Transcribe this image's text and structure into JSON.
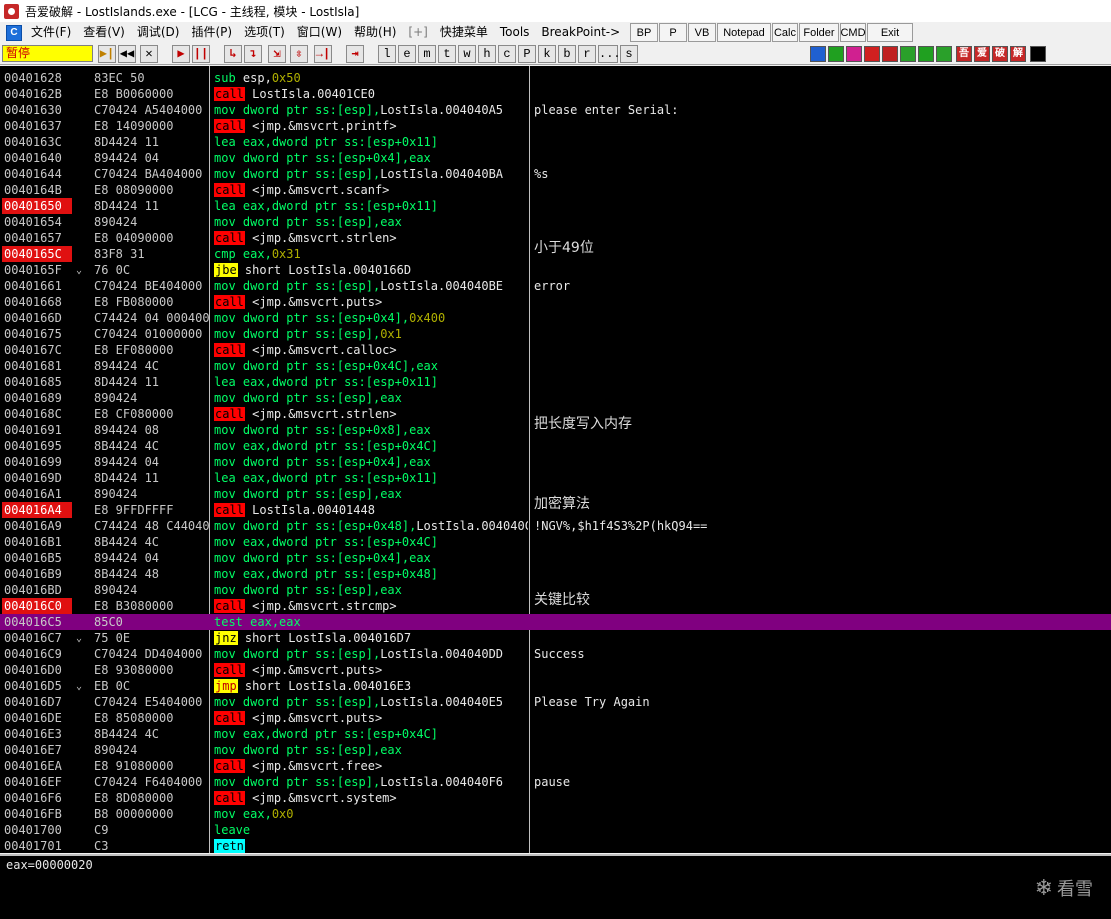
{
  "window": {
    "title": "吾爱破解 - LostIslands.exe - [LCG - 主线程, 模块 - LostIsla]"
  },
  "menu": {
    "system_icon_label": "C",
    "items": [
      "文件(F)",
      "查看(V)",
      "调试(D)",
      "插件(P)",
      "选项(T)",
      "窗口(W)",
      "帮助(H)",
      "[+]",
      "快捷菜单",
      "Tools",
      "BreakPoint->"
    ],
    "plugins": [
      "BP",
      "P",
      "VB",
      "Notepad",
      "Calc",
      "Folder",
      "CMD",
      "Exit"
    ]
  },
  "toolbar": {
    "status": "暂停",
    "buttons": [
      "▶|",
      "◀◀",
      "✕",
      "▶",
      "||",
      "↳",
      "↴",
      "⇲",
      "⇳",
      "→|",
      "⇥"
    ],
    "letters": [
      "l",
      "e",
      "m",
      "t",
      "w",
      "h",
      "c",
      "P",
      "k",
      "b",
      "r",
      "...",
      "s"
    ],
    "right_icons": [
      "吾",
      "爱",
      "破",
      "解"
    ]
  },
  "disasm": {
    "rows": [
      {
        "addr": "00401628",
        "bp": false,
        "j": "",
        "hex": "83EC 50",
        "m": "sub",
        "mt": "normal",
        "ops": [
          [
            "esp,",
            "w"
          ],
          [
            "0x50",
            "g"
          ]
        ],
        "cmt": "",
        "cn": false
      },
      {
        "addr": "0040162B",
        "bp": false,
        "j": "",
        "hex": "E8 B0060000",
        "m": "call",
        "mt": "call",
        "ops": [
          [
            "LostIsla.00401CE0",
            "w"
          ]
        ],
        "cmt": "",
        "cn": false
      },
      {
        "addr": "00401630",
        "bp": false,
        "j": "",
        "hex": "C70424 A5404000",
        "m": "mov",
        "mt": "normal",
        "ops": [
          [
            "dword ptr ss:[esp],",
            "g"
          ],
          [
            "LostIsla.004040A5",
            "w"
          ]
        ],
        "cmt": "please enter Serial:",
        "cn": false
      },
      {
        "addr": "00401637",
        "bp": false,
        "j": "",
        "hex": "E8 14090000",
        "m": "call",
        "mt": "call",
        "ops": [
          [
            "<jmp.&msvcrt.printf>",
            "w"
          ]
        ],
        "cmt": "",
        "cn": false
      },
      {
        "addr": "0040163C",
        "bp": false,
        "j": "",
        "hex": "8D4424 11",
        "m": "lea",
        "mt": "normal",
        "ops": [
          [
            "eax,dword ptr ss:[esp+0x11]",
            "g"
          ]
        ],
        "cmt": "",
        "cn": false
      },
      {
        "addr": "00401640",
        "bp": false,
        "j": "",
        "hex": "894424 04",
        "m": "mov",
        "mt": "normal",
        "ops": [
          [
            "dword ptr ss:[esp+0x4],eax",
            "g"
          ]
        ],
        "cmt": "",
        "cn": false
      },
      {
        "addr": "00401644",
        "bp": false,
        "j": "",
        "hex": "C70424 BA404000",
        "m": "mov",
        "mt": "normal",
        "ops": [
          [
            "dword ptr ss:[esp],",
            "g"
          ],
          [
            "LostIsla.004040BA",
            "w"
          ]
        ],
        "cmt": "%s",
        "cn": false
      },
      {
        "addr": "0040164B",
        "bp": false,
        "j": "",
        "hex": "E8 08090000",
        "m": "call",
        "mt": "call",
        "ops": [
          [
            "<jmp.&msvcrt.scanf>",
            "w"
          ]
        ],
        "cmt": "",
        "cn": false
      },
      {
        "addr": "00401650",
        "bp": true,
        "j": "",
        "hex": "8D4424 11",
        "m": "lea",
        "mt": "normal",
        "ops": [
          [
            "eax,dword ptr ss:[esp+0x11]",
            "g"
          ]
        ],
        "cmt": "",
        "cn": false
      },
      {
        "addr": "00401654",
        "bp": false,
        "j": "",
        "hex": "890424",
        "m": "mov",
        "mt": "normal",
        "ops": [
          [
            "dword ptr ss:[esp],eax",
            "g"
          ]
        ],
        "cmt": "",
        "cn": false
      },
      {
        "addr": "00401657",
        "bp": false,
        "j": "",
        "hex": "E8 04090000",
        "m": "call",
        "mt": "call",
        "ops": [
          [
            "<jmp.&msvcrt.strlen>",
            "w"
          ]
        ],
        "cmt": "",
        "cn": false
      },
      {
        "addr": "0040165C",
        "bp": true,
        "j": "",
        "hex": "83F8 31",
        "m": "cmp",
        "mt": "normal",
        "ops": [
          [
            "eax,",
            "g"
          ],
          [
            "0x31",
            "g"
          ]
        ],
        "cmt": "小于49位",
        "cn": true
      },
      {
        "addr": "0040165F",
        "bp": false,
        "j": "⌄",
        "hex": "76 0C",
        "m": "jbe",
        "mt": "jcc",
        "ops": [
          [
            "short LostIsla.0040166D",
            "w"
          ]
        ],
        "cmt": "",
        "cn": false
      },
      {
        "addr": "00401661",
        "bp": false,
        "j": "",
        "hex": "C70424 BE404000",
        "m": "mov",
        "mt": "normal",
        "ops": [
          [
            "dword ptr ss:[esp],",
            "g"
          ],
          [
            "LostIsla.004040BE",
            "w"
          ]
        ],
        "cmt": "error",
        "cn": false
      },
      {
        "addr": "00401668",
        "bp": false,
        "j": "",
        "hex": "E8 FB080000",
        "m": "call",
        "mt": "call",
        "ops": [
          [
            "<jmp.&msvcrt.puts>",
            "w"
          ]
        ],
        "cmt": "",
        "cn": false
      },
      {
        "addr": "0040166D",
        "bp": false,
        "j": "",
        "hex": "C74424 04 00040000",
        "m": "mov",
        "mt": "normal",
        "ops": [
          [
            "dword ptr ss:[esp+0x4],",
            "g"
          ],
          [
            "0x400",
            "y"
          ]
        ],
        "cmt": "",
        "cn": false
      },
      {
        "addr": "00401675",
        "bp": false,
        "j": "",
        "hex": "C70424 01000000",
        "m": "mov",
        "mt": "normal",
        "ops": [
          [
            "dword ptr ss:[esp],",
            "g"
          ],
          [
            "0x1",
            "y"
          ]
        ],
        "cmt": "",
        "cn": false
      },
      {
        "addr": "0040167C",
        "bp": false,
        "j": "",
        "hex": "E8 EF080000",
        "m": "call",
        "mt": "call",
        "ops": [
          [
            "<jmp.&msvcrt.calloc>",
            "w"
          ]
        ],
        "cmt": "",
        "cn": false
      },
      {
        "addr": "00401681",
        "bp": false,
        "j": "",
        "hex": "894424 4C",
        "m": "mov",
        "mt": "normal",
        "ops": [
          [
            "dword ptr ss:[esp+0x4C],eax",
            "g"
          ]
        ],
        "cmt": "",
        "cn": false
      },
      {
        "addr": "00401685",
        "bp": false,
        "j": "",
        "hex": "8D4424 11",
        "m": "lea",
        "mt": "normal",
        "ops": [
          [
            "eax,dword ptr ss:[esp+0x11]",
            "g"
          ]
        ],
        "cmt": "",
        "cn": false
      },
      {
        "addr": "00401689",
        "bp": false,
        "j": "",
        "hex": "890424",
        "m": "mov",
        "mt": "normal",
        "ops": [
          [
            "dword ptr ss:[esp],eax",
            "g"
          ]
        ],
        "cmt": "",
        "cn": false
      },
      {
        "addr": "0040168C",
        "bp": false,
        "j": "",
        "hex": "E8 CF080000",
        "m": "call",
        "mt": "call",
        "ops": [
          [
            "<jmp.&msvcrt.strlen>",
            "w"
          ]
        ],
        "cmt": "",
        "cn": false
      },
      {
        "addr": "00401691",
        "bp": false,
        "j": "",
        "hex": "894424 08",
        "m": "mov",
        "mt": "normal",
        "ops": [
          [
            "dword ptr ss:[esp+0x8],eax",
            "g"
          ]
        ],
        "cmt": "把长度写入内存",
        "cn": true
      },
      {
        "addr": "00401695",
        "bp": false,
        "j": "",
        "hex": "8B4424 4C",
        "m": "mov",
        "mt": "normal",
        "ops": [
          [
            "eax,dword ptr ss:[esp+0x4C]",
            "g"
          ]
        ],
        "cmt": "",
        "cn": false
      },
      {
        "addr": "00401699",
        "bp": false,
        "j": "",
        "hex": "894424 04",
        "m": "mov",
        "mt": "normal",
        "ops": [
          [
            "dword ptr ss:[esp+0x4],eax",
            "g"
          ]
        ],
        "cmt": "",
        "cn": false
      },
      {
        "addr": "0040169D",
        "bp": false,
        "j": "",
        "hex": "8D4424 11",
        "m": "lea",
        "mt": "normal",
        "ops": [
          [
            "eax,dword ptr ss:[esp+0x11]",
            "g"
          ]
        ],
        "cmt": "",
        "cn": false
      },
      {
        "addr": "004016A1",
        "bp": false,
        "j": "",
        "hex": "890424",
        "m": "mov",
        "mt": "normal",
        "ops": [
          [
            "dword ptr ss:[esp],eax",
            "g"
          ]
        ],
        "cmt": "",
        "cn": false
      },
      {
        "addr": "004016A4",
        "bp": true,
        "j": "",
        "hex": "E8 9FFDFFFF",
        "m": "call",
        "mt": "call",
        "ops": [
          [
            "LostIsla.00401448",
            "w"
          ]
        ],
        "cmt": "加密算法",
        "cn": true
      },
      {
        "addr": "004016A9",
        "bp": false,
        "j": "",
        "hex": "C74424 48 C4404000",
        "m": "mov",
        "mt": "normal",
        "ops": [
          [
            "dword ptr ss:[esp+0x48],",
            "g"
          ],
          [
            "LostIsla.004040C4",
            "w"
          ]
        ],
        "cmt": "!NGV%,$h1f4S3%2P(hkQ94==",
        "cn": false
      },
      {
        "addr": "004016B1",
        "bp": false,
        "j": "",
        "hex": "8B4424 4C",
        "m": "mov",
        "mt": "normal",
        "ops": [
          [
            "eax,dword ptr ss:[esp+0x4C]",
            "g"
          ]
        ],
        "cmt": "",
        "cn": false
      },
      {
        "addr": "004016B5",
        "bp": false,
        "j": "",
        "hex": "894424 04",
        "m": "mov",
        "mt": "normal",
        "ops": [
          [
            "dword ptr ss:[esp+0x4],eax",
            "g"
          ]
        ],
        "cmt": "",
        "cn": false
      },
      {
        "addr": "004016B9",
        "bp": false,
        "j": "",
        "hex": "8B4424 48",
        "m": "mov",
        "mt": "normal",
        "ops": [
          [
            "eax,dword ptr ss:[esp+0x48]",
            "g"
          ]
        ],
        "cmt": "",
        "cn": false
      },
      {
        "addr": "004016BD",
        "bp": false,
        "j": "",
        "hex": "890424",
        "m": "mov",
        "mt": "normal",
        "ops": [
          [
            "dword ptr ss:[esp],eax",
            "g"
          ]
        ],
        "cmt": "",
        "cn": false
      },
      {
        "addr": "004016C0",
        "bp": true,
        "j": "",
        "hex": "E8 B3080000",
        "m": "call",
        "mt": "call",
        "ops": [
          [
            "<jmp.&msvcrt.strcmp>",
            "w"
          ]
        ],
        "cmt": "关键比较",
        "cn": true
      },
      {
        "addr": "004016C5",
        "bp": false,
        "j": "",
        "hex": "85C0",
        "m": "test",
        "mt": "normal",
        "ops": [
          [
            "eax,eax",
            "g"
          ]
        ],
        "cmt": "",
        "cn": false,
        "selected": true
      },
      {
        "addr": "004016C7",
        "bp": false,
        "j": "⌄",
        "hex": "75 0E",
        "m": "jnz",
        "mt": "jcc",
        "ops": [
          [
            "short LostIsla.004016D7",
            "w"
          ]
        ],
        "cmt": "",
        "cn": false
      },
      {
        "addr": "004016C9",
        "bp": false,
        "j": "",
        "hex": "C70424 DD404000",
        "m": "mov",
        "mt": "normal",
        "ops": [
          [
            "dword ptr ss:[esp],",
            "g"
          ],
          [
            "LostIsla.004040DD",
            "w"
          ]
        ],
        "cmt": "Success",
        "cn": false
      },
      {
        "addr": "004016D0",
        "bp": false,
        "j": "",
        "hex": "E8 93080000",
        "m": "call",
        "mt": "call",
        "ops": [
          [
            "<jmp.&msvcrt.puts>",
            "w"
          ]
        ],
        "cmt": "",
        "cn": false
      },
      {
        "addr": "004016D5",
        "bp": false,
        "j": "⌄",
        "hex": "EB 0C",
        "m": "jmp",
        "mt": "jmp",
        "ops": [
          [
            "short LostIsla.004016E3",
            "w"
          ]
        ],
        "cmt": "",
        "cn": false
      },
      {
        "addr": "004016D7",
        "bp": false,
        "j": "",
        "hex": "C70424 E5404000",
        "m": "mov",
        "mt": "normal",
        "ops": [
          [
            "dword ptr ss:[esp],",
            "g"
          ],
          [
            "LostIsla.004040E5",
            "w"
          ]
        ],
        "cmt": "Please Try Again",
        "cn": false
      },
      {
        "addr": "004016DE",
        "bp": false,
        "j": "",
        "hex": "E8 85080000",
        "m": "call",
        "mt": "call",
        "ops": [
          [
            "<jmp.&msvcrt.puts>",
            "w"
          ]
        ],
        "cmt": "",
        "cn": false
      },
      {
        "addr": "004016E3",
        "bp": false,
        "j": "",
        "hex": "8B4424 4C",
        "m": "mov",
        "mt": "normal",
        "ops": [
          [
            "eax,dword ptr ss:[esp+0x4C]",
            "g"
          ]
        ],
        "cmt": "",
        "cn": false
      },
      {
        "addr": "004016E7",
        "bp": false,
        "j": "",
        "hex": "890424",
        "m": "mov",
        "mt": "normal",
        "ops": [
          [
            "dword ptr ss:[esp],eax",
            "g"
          ]
        ],
        "cmt": "",
        "cn": false
      },
      {
        "addr": "004016EA",
        "bp": false,
        "j": "",
        "hex": "E8 91080000",
        "m": "call",
        "mt": "call",
        "ops": [
          [
            "<jmp.&msvcrt.free>",
            "w"
          ]
        ],
        "cmt": "",
        "cn": false
      },
      {
        "addr": "004016EF",
        "bp": false,
        "j": "",
        "hex": "C70424 F6404000",
        "m": "mov",
        "mt": "normal",
        "ops": [
          [
            "dword ptr ss:[esp],",
            "g"
          ],
          [
            "LostIsla.004040F6",
            "w"
          ]
        ],
        "cmt": "pause",
        "cn": false
      },
      {
        "addr": "004016F6",
        "bp": false,
        "j": "",
        "hex": "E8 8D080000",
        "m": "call",
        "mt": "call",
        "ops": [
          [
            "<jmp.&msvcrt.system>",
            "w"
          ]
        ],
        "cmt": "",
        "cn": false
      },
      {
        "addr": "004016FB",
        "bp": false,
        "j": "",
        "hex": "B8 00000000",
        "m": "mov",
        "mt": "normal",
        "ops": [
          [
            "eax,",
            "g"
          ],
          [
            "0x0",
            "y"
          ]
        ],
        "cmt": "",
        "cn": false
      },
      {
        "addr": "00401700",
        "bp": false,
        "j": "",
        "hex": "C9",
        "m": "leave",
        "mt": "normal",
        "ops": [],
        "cmt": "",
        "cn": false
      },
      {
        "addr": "00401701",
        "bp": false,
        "j": "",
        "hex": "C3",
        "m": "retn",
        "mt": "retn",
        "ops": [],
        "cmt": "",
        "cn": false
      }
    ]
  },
  "info": {
    "register": "eax=00000020"
  },
  "watermark": {
    "text": "看雪"
  },
  "colors": {
    "breakpoint": "#e01010",
    "selected_row": "#800080",
    "mnemonic": "#00ff66",
    "call_bg": "#ff0000",
    "jcc_bg": "#ffff00",
    "retn_bg": "#00ffff"
  }
}
